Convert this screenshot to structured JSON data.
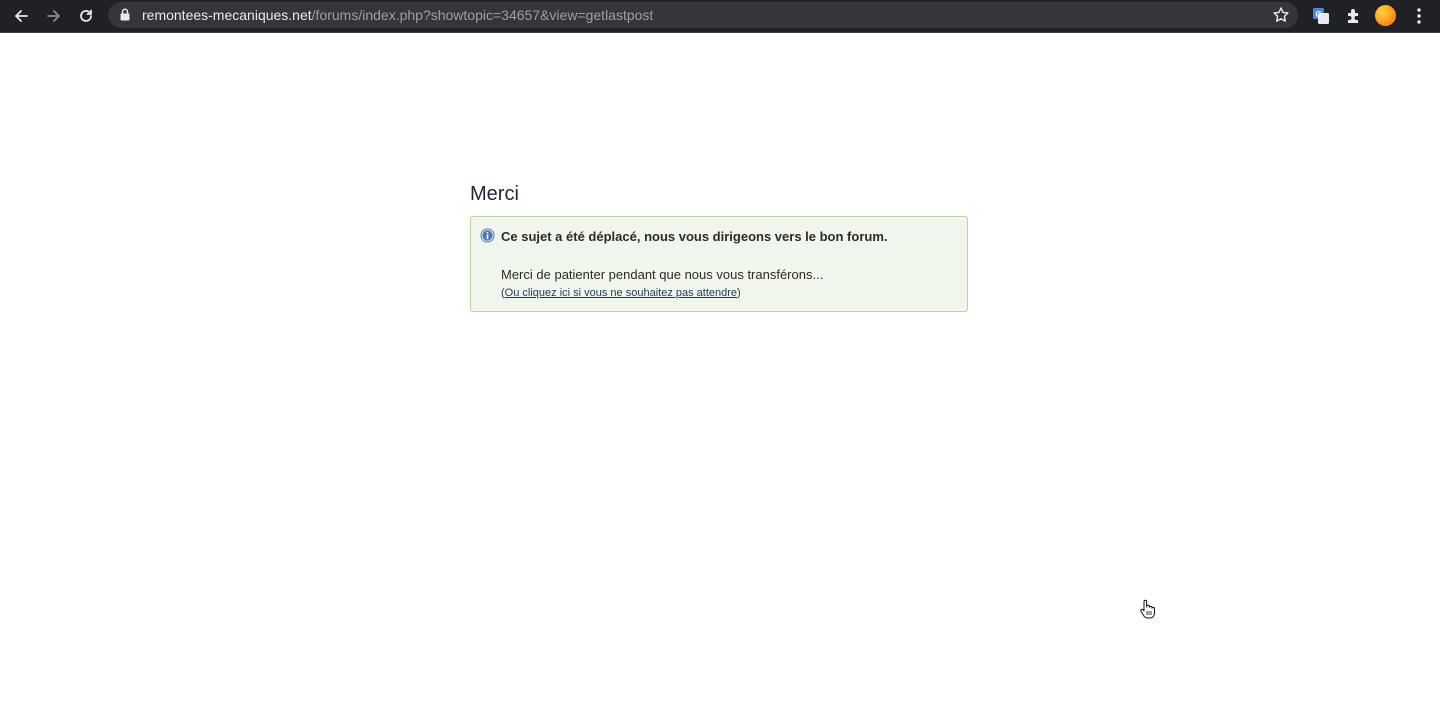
{
  "browser": {
    "url_host": "remontees-mecaniques.net",
    "url_path": "/forums/index.php?showtopic=34657&view=getlastpost",
    "icons": {
      "back": "arrow-left-icon",
      "forward": "arrow-right-icon",
      "reload": "reload-icon",
      "lock": "lock-icon",
      "bookmark": "star-icon",
      "translate": "translate-icon",
      "extensions": "puzzle-icon",
      "profile": "avatar",
      "menu": "kebab-menu-icon"
    }
  },
  "page": {
    "title": "Merci",
    "message": {
      "heading": "Ce sujet a été déplacé, nous vous dirigeons vers le bon forum.",
      "body": "Merci de patienter pendant que nous vous transférons...",
      "link_prefix": "(",
      "link_text": "Ou cliquez ici si vous ne souhaitez pas attendre",
      "link_suffix": ")"
    }
  },
  "colors": {
    "toolbar_bg": "#202124",
    "omnibox_bg": "#35363a",
    "message_bg": "#f1f6ec",
    "message_border": "#b5d69f",
    "info_icon": "#4a77b4"
  }
}
